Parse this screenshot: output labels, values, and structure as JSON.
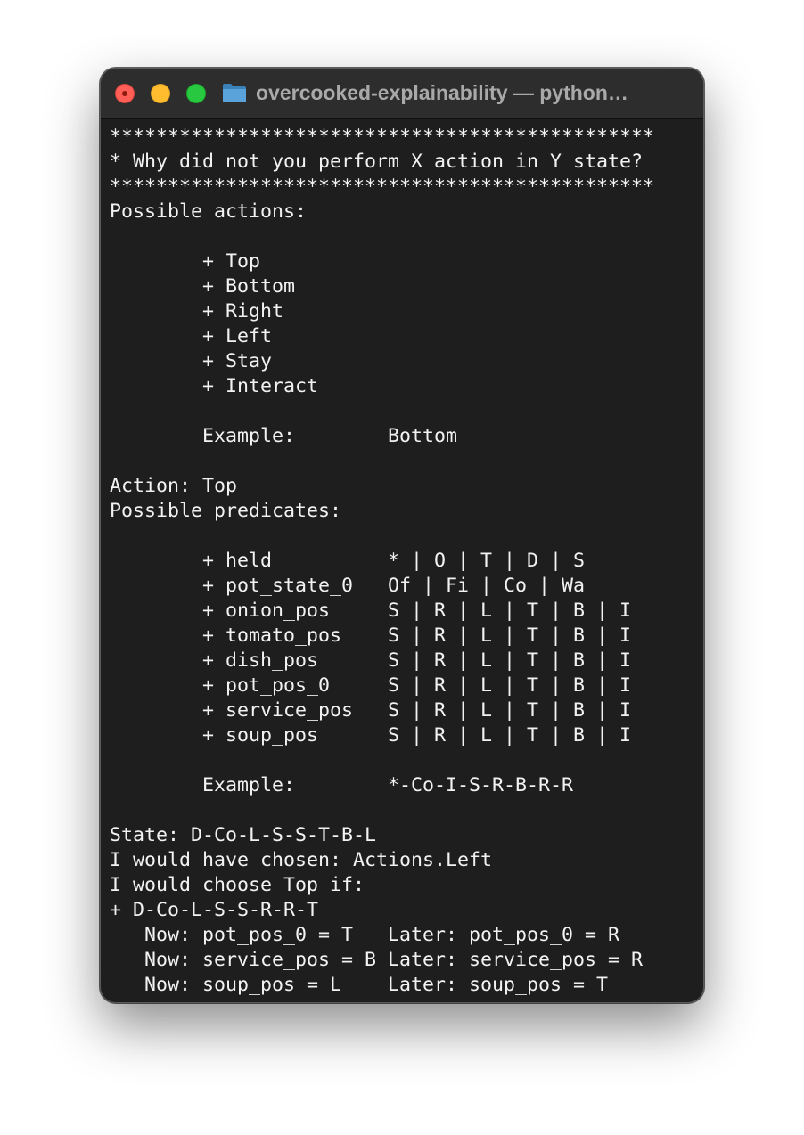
{
  "window": {
    "title": "overcooked-explainability — python…"
  },
  "terminal": {
    "lines": [
      "***********************************************",
      "* Why did not you perform X action in Y state?",
      "***********************************************",
      "Possible actions:",
      "",
      "        + Top",
      "        + Bottom",
      "        + Right",
      "        + Left",
      "        + Stay",
      "        + Interact",
      "",
      "        Example:        Bottom",
      "",
      "Action: Top",
      "Possible predicates:",
      "",
      "        + held          * | O | T | D | S",
      "        + pot_state_0   Of | Fi | Co | Wa",
      "        + onion_pos     S | R | L | T | B | I",
      "        + tomato_pos    S | R | L | T | B | I",
      "        + dish_pos      S | R | L | T | B | I",
      "        + pot_pos_0     S | R | L | T | B | I",
      "        + service_pos   S | R | L | T | B | I",
      "        + soup_pos      S | R | L | T | B | I",
      "",
      "        Example:        *-Co-I-S-R-B-R-R",
      "",
      "State: D-Co-L-S-S-T-B-L",
      "I would have chosen: Actions.Left",
      "I would choose Top if:",
      "+ D-Co-L-S-S-R-R-T",
      "   Now: pot_pos_0 = T   Later: pot_pos_0 = R",
      "   Now: service_pos = B Later: service_pos = R",
      "   Now: soup_pos = L    Later: soup_pos = T"
    ]
  }
}
